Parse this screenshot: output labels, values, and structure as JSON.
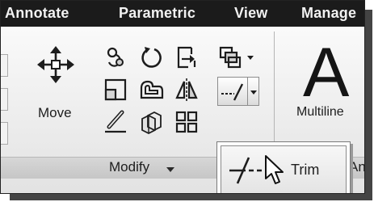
{
  "tabs": [
    {
      "label": "Annotate"
    },
    {
      "label": "Parametric"
    },
    {
      "label": "View"
    },
    {
      "label": "Manage"
    }
  ],
  "modify_panel": {
    "move_label": "Move",
    "panel_label": "Modify",
    "dropdown_icon": "chevron-down-icon",
    "tools": [
      "rotate-copy-icon",
      "rotate-icon",
      "explode-icon",
      "scale-icon",
      "offset-icon",
      "mirror-icon",
      "erase-icon",
      "copy-3d-icon",
      "array-icon"
    ]
  },
  "annotation_panel": {
    "text_glyph": "A",
    "multiline_label": "Multiline",
    "footer_label_fragment": "An"
  },
  "trim_flyout": {
    "item_label": "Trim",
    "item_icon": "trim-icon"
  },
  "cursor": {
    "icon": "mouse-pointer-icon"
  }
}
